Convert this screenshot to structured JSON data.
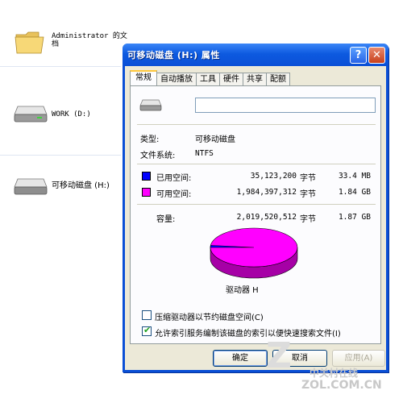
{
  "desktop": {
    "items": [
      {
        "label_line1": "Administrator 的文",
        "label_line2": "档",
        "icon": "folder-icon"
      },
      {
        "label": "WORK (D:)",
        "icon": "hard-drive-icon"
      },
      {
        "label": "可移动磁盘 (H:)",
        "icon": "removable-drive-icon"
      }
    ]
  },
  "dialog": {
    "title": "可移动磁盘 (H:) 属性",
    "help_glyph": "?",
    "close_glyph": "✕",
    "tabs": [
      "常规",
      "自动播放",
      "工具",
      "硬件",
      "共享",
      "配额"
    ],
    "name_value": "",
    "type_label": "类型:",
    "type_value": "可移动磁盘",
    "fs_label": "文件系统:",
    "fs_value": "NTFS",
    "used": {
      "label": "已用空间:",
      "bytes": "35,123,200",
      "unit": "字节",
      "size": "33.4 MB",
      "color": "#0000ff"
    },
    "free": {
      "label": "可用空间:",
      "bytes": "1,984,397,312",
      "unit": "字节",
      "size": "1.84 GB",
      "color": "#ff00ff"
    },
    "capacity": {
      "label": "容量:",
      "bytes": "2,019,520,512",
      "unit": "字节",
      "size": "1.87 GB"
    },
    "drive_label": "驱动器 H",
    "used_fraction": 0.0174,
    "compress_label": "压缩驱动器以节约磁盘空间(C)",
    "compress_checked": false,
    "index_label": "允许索引服务编制该磁盘的索引以便快速搜索文件(I)",
    "index_checked": true,
    "ok_label": "确定",
    "cancel_label": "取消",
    "apply_label": "应用(A)"
  },
  "watermark": {
    "main": "中关村在线",
    "sub": "ZOL.COM.CN"
  }
}
